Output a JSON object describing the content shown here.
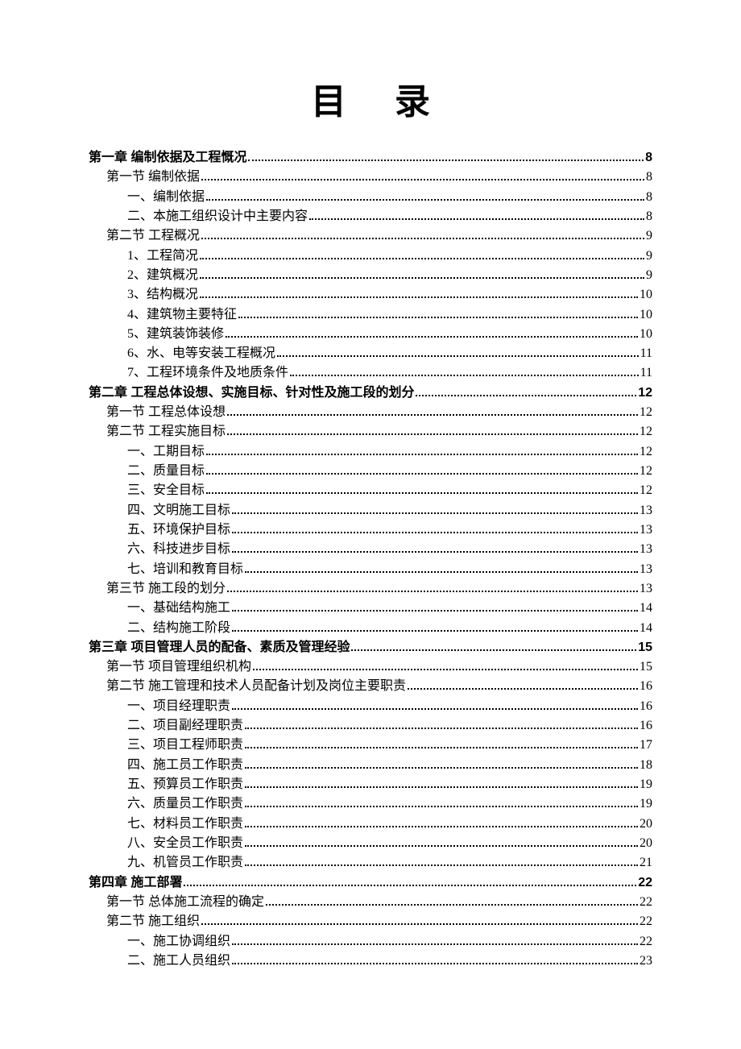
{
  "title": "目录",
  "entries": [
    {
      "level": 0,
      "label": "第一章  编制依据及工程慨况",
      "page": "8"
    },
    {
      "level": 1,
      "label": "第一节  编制依据",
      "page": "8"
    },
    {
      "level": 2,
      "label": "一、编制依据",
      "page": "8"
    },
    {
      "level": 2,
      "label": "二、本施工组织设计中主要内容",
      "page": "8"
    },
    {
      "level": 1,
      "label": "第二节  工程概况",
      "page": "9"
    },
    {
      "level": 2,
      "label": "1、工程简况",
      "page": "9"
    },
    {
      "level": 2,
      "label": "2、建筑概况",
      "page": "9"
    },
    {
      "level": 2,
      "label": "3、结构概况",
      "page": "10"
    },
    {
      "level": 2,
      "label": "4、建筑物主要特征",
      "page": "10"
    },
    {
      "level": 2,
      "label": "5、建筑装饰装修",
      "page": "10"
    },
    {
      "level": 2,
      "label": "6、水、电等安装工程概况",
      "page": "11"
    },
    {
      "level": 2,
      "label": "7、工程环境条件及地质条件",
      "page": "11"
    },
    {
      "level": 0,
      "label": "第二章  工程总体设想、实施目标、针对性及施工段的划分",
      "page": "12"
    },
    {
      "level": 1,
      "label": "第一节  工程总体设想",
      "page": "12"
    },
    {
      "level": 1,
      "label": "第二节  工程实施目标",
      "page": "12"
    },
    {
      "level": 2,
      "label": "一、工期目标",
      "page": "12"
    },
    {
      "level": 2,
      "label": "二、质量目标",
      "page": "12"
    },
    {
      "level": 2,
      "label": "三、安全目标",
      "page": "12"
    },
    {
      "level": 2,
      "label": "四、文明施工目标",
      "page": "13"
    },
    {
      "level": 2,
      "label": "五、环境保护目标",
      "page": "13"
    },
    {
      "level": 2,
      "label": "六、科技进步目标",
      "page": "13"
    },
    {
      "level": 2,
      "label": "七、培训和教育目标",
      "page": "13"
    },
    {
      "level": 1,
      "label": "第三节  施工段的划分",
      "page": "13"
    },
    {
      "level": 2,
      "label": "一、基础结构施工",
      "page": "14"
    },
    {
      "level": 2,
      "label": "二、结构施工阶段",
      "page": "14"
    },
    {
      "level": 0,
      "label": "第三章  项目管理人员的配备、素质及管理经验",
      "page": "15"
    },
    {
      "level": 1,
      "label": "第一节 项目管理组织机构",
      "page": "15"
    },
    {
      "level": 1,
      "label": "第二节 施工管理和技术人员配备计划及岗位主要职责",
      "page": "16"
    },
    {
      "level": 2,
      "label": "一、项目经理职责",
      "page": "16"
    },
    {
      "level": 2,
      "label": "二、项目副经理职责",
      "page": "16"
    },
    {
      "level": 2,
      "label": "三、项目工程师职责",
      "page": "17"
    },
    {
      "level": 2,
      "label": "四、施工员工作职责",
      "page": "18"
    },
    {
      "level": 2,
      "label": "五、预算员工作职责",
      "page": "19"
    },
    {
      "level": 2,
      "label": "六、质量员工作职责",
      "page": "19"
    },
    {
      "level": 2,
      "label": "七、材料员工作职责",
      "page": "20"
    },
    {
      "level": 2,
      "label": "八、安全员工作职责",
      "page": "20"
    },
    {
      "level": 2,
      "label": "九、机管员工作职责",
      "page": "21"
    },
    {
      "level": 0,
      "label": "第四章  施工部署",
      "page": "22"
    },
    {
      "level": 1,
      "label": "第一节  总体施工流程的确定",
      "page": "22"
    },
    {
      "level": 1,
      "label": "第二节  施工组织",
      "page": "22"
    },
    {
      "level": 2,
      "label": "一、施工协调组织",
      "page": "22"
    },
    {
      "level": 2,
      "label": "二、施工人员组织",
      "page": "23"
    }
  ]
}
